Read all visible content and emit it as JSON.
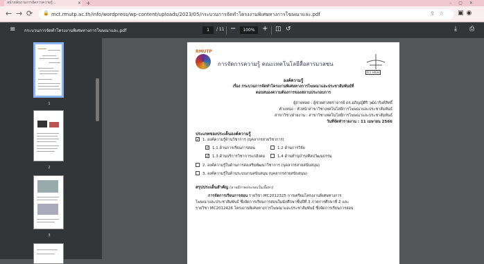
{
  "browser": {
    "tab_title": "หน้าหลักงานการจัดการความรู้...",
    "url": "mct.rmutp.ac.th/info/wordpress/wp-content/uploads/2023/05/กระบวนการจัดทำโครงงานพิเศษทางการโฆษณาและ.pdf"
  },
  "viewer": {
    "doc_title": "กระบวนการจัดทำโครงงานพิเศษทางการโฆษณาและ.pdf",
    "current_page": "1",
    "page_count": "/ 11",
    "zoom": "100%"
  },
  "thumbnails": [
    {
      "num": "1"
    },
    {
      "num": "2"
    },
    {
      "num": "3"
    }
  ],
  "page": {
    "brand": "RMUTP",
    "org_title": "การจัดการความรู้ คณะเทคโนโลยีสื่อสารมวลชน",
    "flyhigh": "FLY HIGH",
    "heading": "องค์ความรู้",
    "subject_line1": "เรื่อง  กระบวนการจัดทำโครงงานพิเศษทางการโฆษณาและประชาสัมพันธ์ที่",
    "subject_line2": "ตอบสนองความต้องการของสถานประกอบการ",
    "author": "ผู้ถ่ายทอด : ผู้ช่วยศาสตราจารย์ ดร.อภิญญ์ศิริ วุฒิธาริงค์สิทธิ์",
    "position": "ตำแหน่ง : หัวหน้าสาขาวิชาเทคโนโลยีการโฆษณาและประชาสัมพันธ์",
    "department": "สาขาวิชา/ฝ่ายงาน : สาขาวิชาเทคโนโลยีการโฆษณาและประชาสัมพันธ์",
    "report_date": "วันที่จัดทำรายงาน : 11 เมษายน 2566",
    "type_heading": "ประเภทของประเด็นองค์ความรู้",
    "opt1": "1. องค์ความรู้ด้านวิชาการ (บุคลากรสายวิชาการ)",
    "opt1_1": "1.1 ด้านการเรียนการสอน",
    "opt1_2": "1.2 ด้านการวิจัย",
    "opt1_3": "1.3 ด้านบริการวิชาการแก่สังคม",
    "opt1_4": "1.4 ด้านทำนุบำรุงศิลปวัฒนธรรม",
    "opt2": "2. องค์ความรู้ในด้านการส่งเสริมพัฒนาวิชาการ (บุคลากรสายสนับสนุน)",
    "opt3": "3. องค์ความรู้ในด้านระบบงานสนับสนุน (บุคลากรสายสนับสนุน)",
    "summary_heading": "สรุปประเด็นสำคัญ",
    "summary_note": "(อาจมีภาพประกอบในเนื้อหา)",
    "body1_bold": "การจัดการเรียนการสอน",
    "body1": "รายวิชา MC2012325 การเตรียมโครงงานพิเศษทางการ",
    "body2": "โฆษณาและประชาสัมพันธ์ ซึ่งจัดการเรียนการสอนในนักศึกษาชั้นปีที่ 3 ภาคการศึกษาที่ 2 และ",
    "body3": "รายวิชา MC2012426 โครงงานพิเศษทางการโฆษณาและประชาสัมพันธ์ ซึ่งจัดการเรียนการสอน"
  }
}
